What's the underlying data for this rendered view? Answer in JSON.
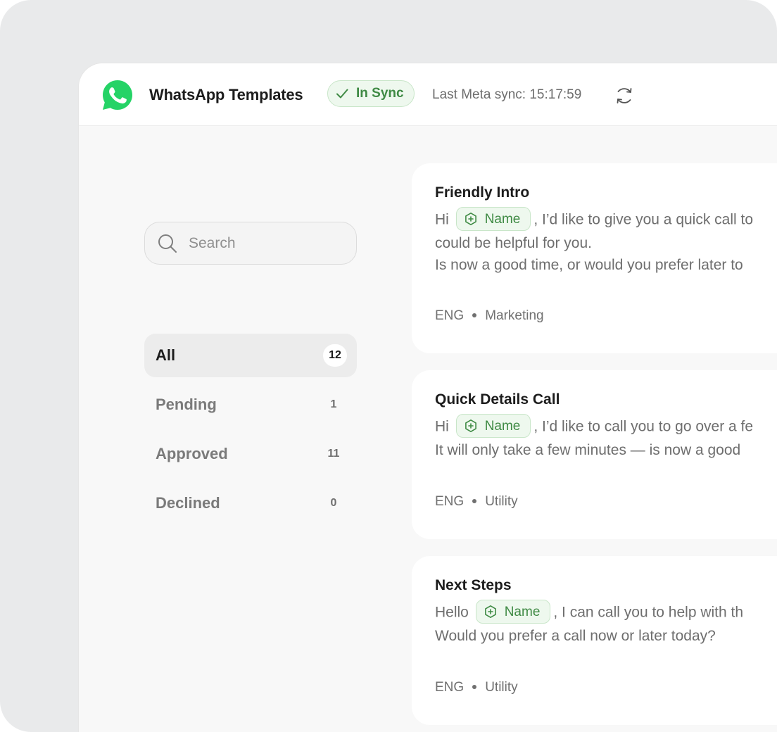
{
  "header": {
    "title": "WhatsApp Templates",
    "sync_status": "In Sync",
    "last_sync": "Last Meta sync: 15:17:59",
    "logo_icon": "whatsapp-logo-icon",
    "refresh_icon": "refresh-icon",
    "brand_color": "#25D366",
    "status_color": "#3f8a44"
  },
  "sidebar": {
    "search_placeholder": "Search",
    "filters": [
      {
        "label": "All",
        "count": "12",
        "active": true
      },
      {
        "label": "Pending",
        "count": "1",
        "active": false
      },
      {
        "label": "Approved",
        "count": "11",
        "active": false
      },
      {
        "label": "Declined",
        "count": "0",
        "active": false
      }
    ]
  },
  "templates": [
    {
      "title": "Friendly Intro",
      "greeting": "Hi",
      "variable": "Name",
      "line1_rest": ", I’d like to give you a quick call to",
      "line2": "could be helpful for you.",
      "line3": "Is now a good time, or would you prefer later to",
      "language": "ENG",
      "category": "Marketing"
    },
    {
      "title": "Quick Details Call",
      "greeting": "Hi",
      "variable": "Name",
      "line1_rest": ", I’d like to call you to go over a fe",
      "line2": "It will only take a few minutes — is now a good",
      "language": "ENG",
      "category": "Utility"
    },
    {
      "title": "Next Steps",
      "greeting": "Hello",
      "variable": "Name",
      "line1_rest": ", I can call you to help with th",
      "line2": "Would you prefer a call now or later today?",
      "language": "ENG",
      "category": "Utility"
    }
  ]
}
